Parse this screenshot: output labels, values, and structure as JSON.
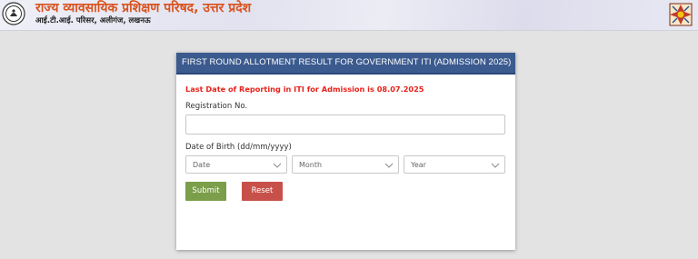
{
  "header": {
    "title": "राज्य व्यावसायिक प्रशिक्षण परिषद, उत्तर प्रदेश",
    "subtitle": "आई.टी.आई. परिसर, अलीगंज, लखनऊ",
    "left_logo_icon": "emblem-icon",
    "right_logo_icon": "state-emblem-icon"
  },
  "card": {
    "title": "FIRST ROUND ALLOTMENT RESULT FOR GOVERNMENT ITI (ADMISSION 2025)",
    "notice": "Last Date of Reporting in ITI for Admission is 08.07.2025",
    "registration_label": "Registration No.",
    "registration_value": "",
    "dob_label": "Date of Birth (dd/mm/yyyy)",
    "date_select": "Date",
    "month_select": "Month",
    "year_select": "Year",
    "submit_label": "Submit",
    "reset_label": "Reset"
  },
  "colors": {
    "card_header": "#3b5b8f",
    "notice": "#e8211a",
    "submit": "#7b9e4a",
    "reset": "#c8504a",
    "header_title": "#d9531e"
  }
}
